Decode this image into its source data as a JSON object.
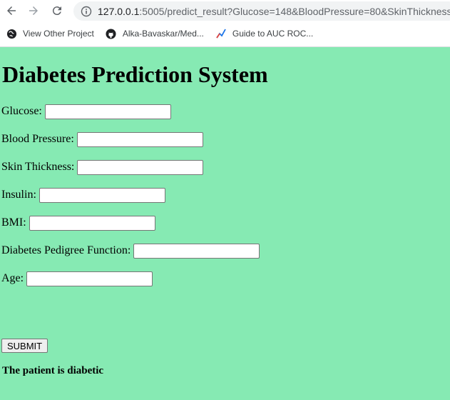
{
  "browser": {
    "url_host": "127.0.0.1",
    "url_rest": ":5005/predict_result?Glucose=148&BloodPressure=80&SkinThickness=...",
    "bookmarks": [
      {
        "label": "View Other Project",
        "icon": "globe-icon"
      },
      {
        "label": "Alka-Bavaskar/Med...",
        "icon": "github-icon"
      },
      {
        "label": "Guide to AUC ROC...",
        "icon": "chart-icon"
      }
    ]
  },
  "page": {
    "title": "Diabetes Prediction System",
    "fields": [
      {
        "label": "Glucose:",
        "value": "",
        "placeholder": ""
      },
      {
        "label": "Blood Pressure:",
        "value": "",
        "placeholder": ""
      },
      {
        "label": "Skin Thickness:",
        "value": "",
        "placeholder": ""
      },
      {
        "label": "Insulin:",
        "value": "",
        "placeholder": ""
      },
      {
        "label": "BMI:",
        "value": "",
        "placeholder": ""
      },
      {
        "label": "Diabetes Pedigree Function:",
        "value": "",
        "placeholder": ""
      },
      {
        "label": "Age:",
        "value": "",
        "placeholder": ""
      }
    ],
    "submit_label": "SUBMIT",
    "result": "The patient is diabetic"
  },
  "colors": {
    "page_background": "#86eab3"
  }
}
